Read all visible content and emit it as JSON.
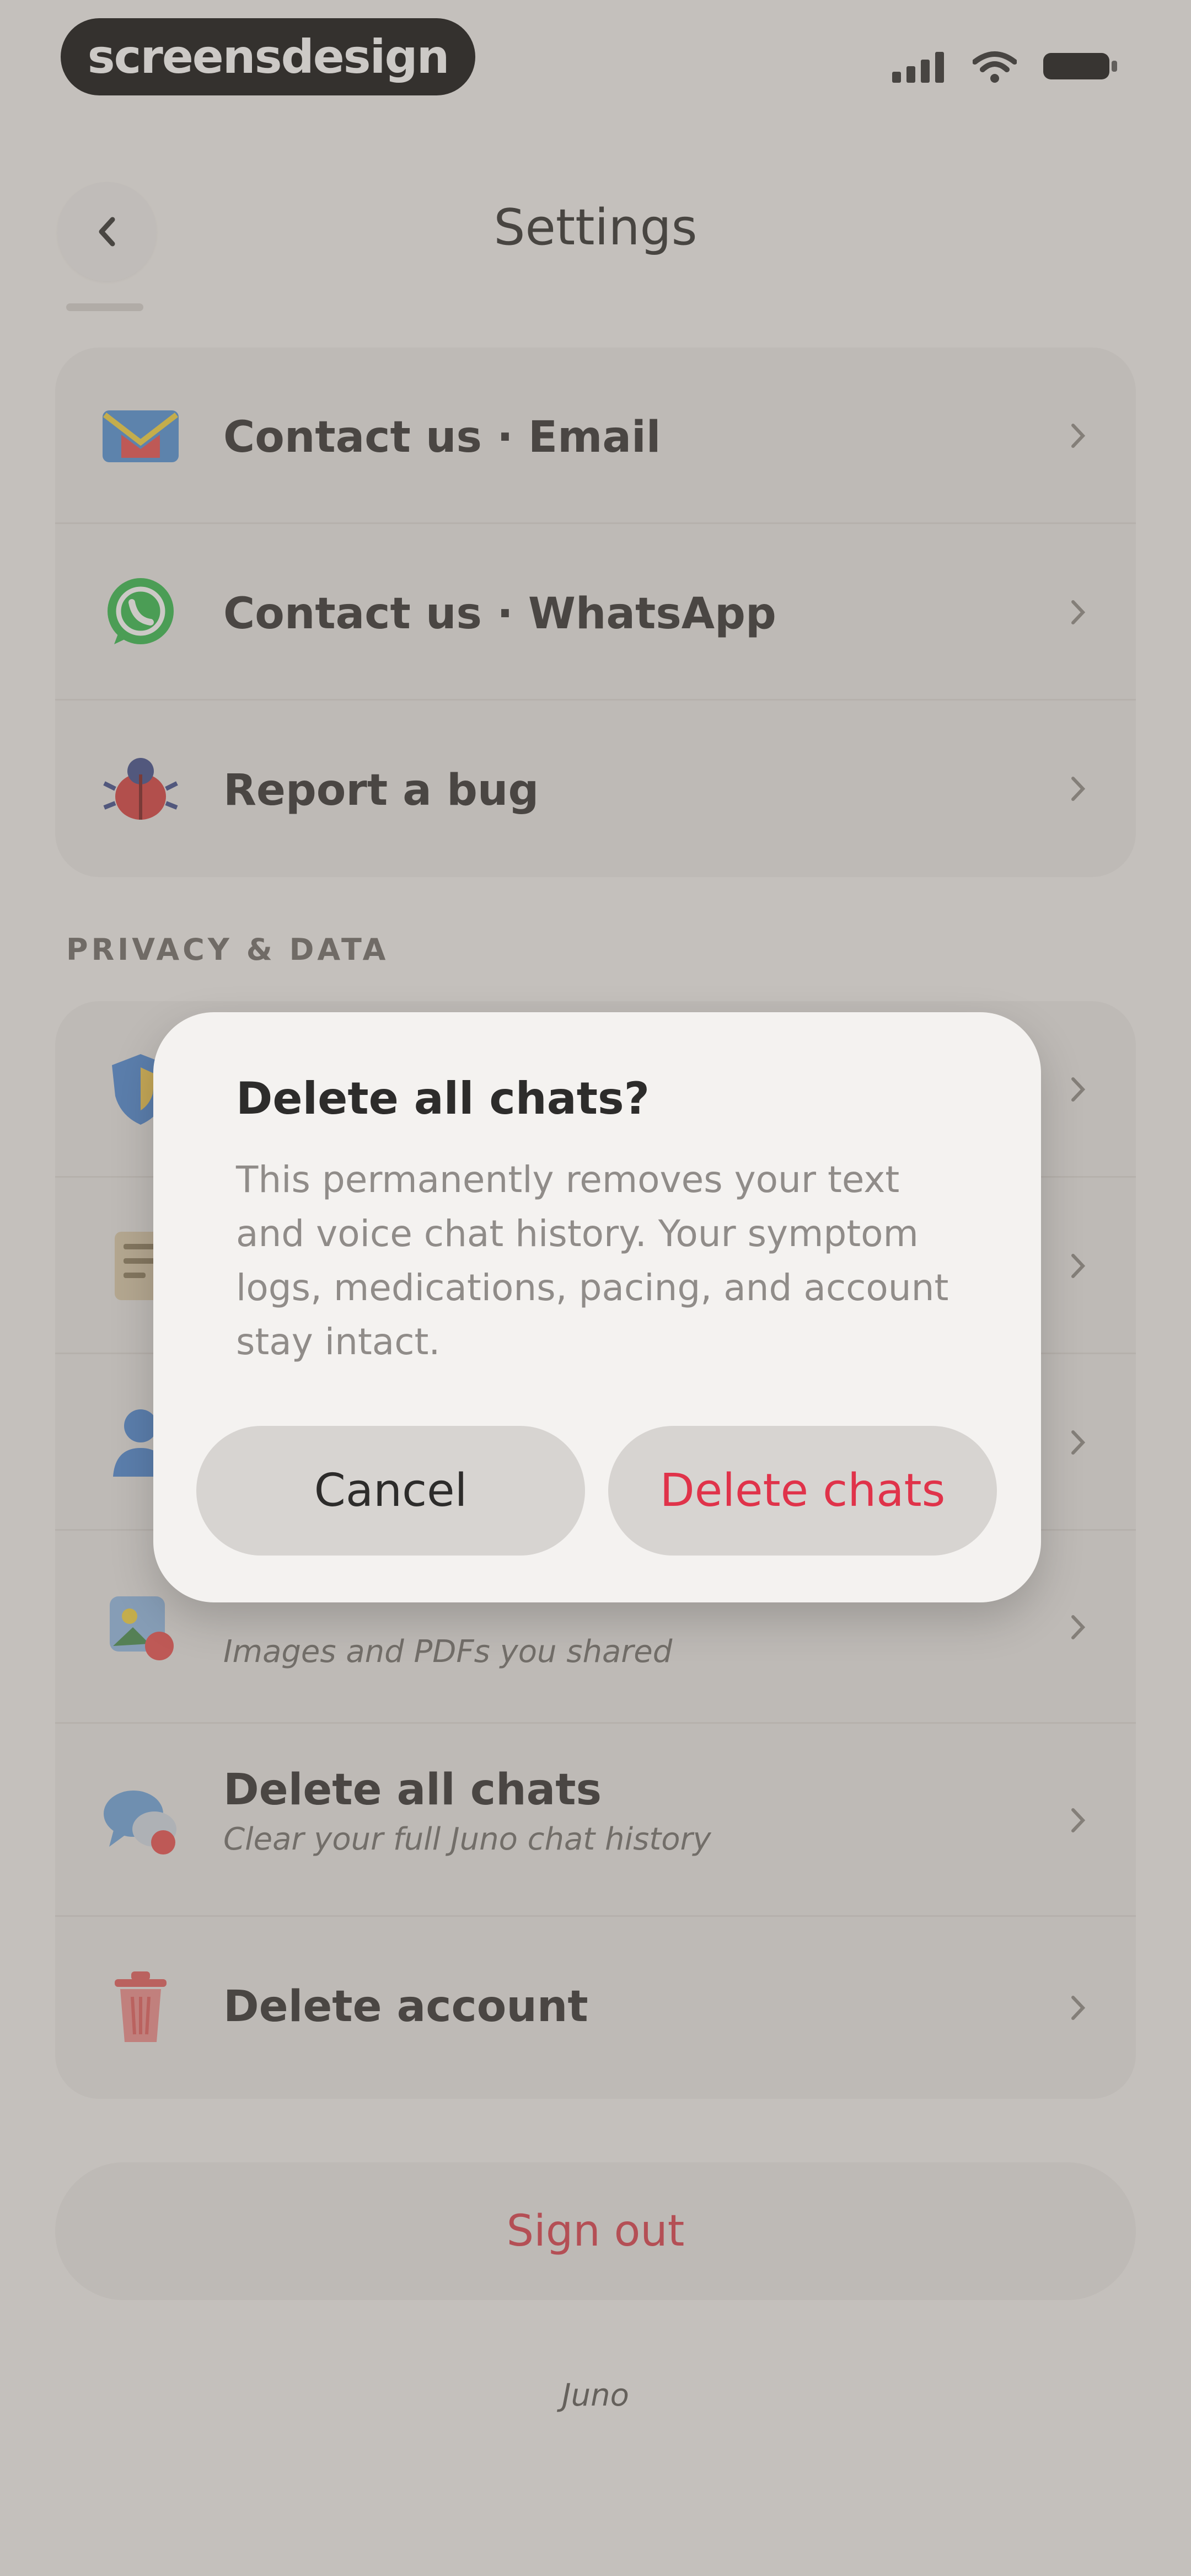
{
  "status_bar": {
    "brand": "screensdesign"
  },
  "header": {
    "title": "Settings"
  },
  "support_group": [
    {
      "label": "Contact us · Email",
      "icon": "envelope-icon"
    },
    {
      "label": "Contact us · WhatsApp",
      "icon": "whatsapp-icon"
    },
    {
      "label": "Report a bug",
      "icon": "bug-icon"
    }
  ],
  "privacy": {
    "section_label": "PRIVACY & DATA",
    "uploads": {
      "subtitle": "Images and PDFs you shared"
    },
    "delete_chats": {
      "label": "Delete all chats",
      "subtitle": "Clear your full Juno chat history"
    },
    "delete_account": {
      "label": "Delete account"
    }
  },
  "signout": {
    "label": "Sign out"
  },
  "footer": {
    "text": "Juno"
  },
  "dialog": {
    "title": "Delete all chats?",
    "body": "This permanently removes your text and voice chat history. Your symptom logs, medications, pacing, and account stay intact.",
    "cancel_label": "Cancel",
    "confirm_label": "Delete chats"
  },
  "colors": {
    "destructive": "#e0334a",
    "background": "#f3f1ef",
    "card": "#e9e7e5"
  }
}
